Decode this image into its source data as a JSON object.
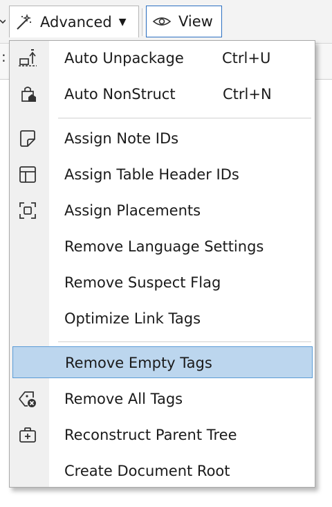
{
  "toolbar": {
    "advanced_label": "Advanced",
    "view_label": "View",
    "accent": "#2b6fc1"
  },
  "menu": {
    "highlight_color": "#bcd6ee",
    "groups": [
      [
        {
          "label": "Auto Unpackage",
          "shortcut": "Ctrl+U",
          "icon": "unpackage-icon"
        },
        {
          "label": "Auto NonStruct",
          "shortcut": "Ctrl+N",
          "icon": "package-tag-icon"
        }
      ],
      [
        {
          "label": "Assign Note IDs",
          "icon": "note-icon"
        },
        {
          "label": "Assign Table Header IDs",
          "icon": "table-header-icon"
        },
        {
          "label": "Assign Placements",
          "icon": "placement-frame-icon"
        },
        {
          "label": "Remove Language Settings"
        },
        {
          "label": "Remove Suspect Flag"
        },
        {
          "label": "Optimize Link Tags"
        }
      ],
      [
        {
          "label": "Remove Empty Tags",
          "highlighted": true
        },
        {
          "label": "Remove All Tags",
          "icon": "tag-remove-icon"
        },
        {
          "label": "Reconstruct Parent Tree",
          "icon": "medical-kit-icon"
        },
        {
          "label": "Create Document Root"
        }
      ]
    ]
  }
}
